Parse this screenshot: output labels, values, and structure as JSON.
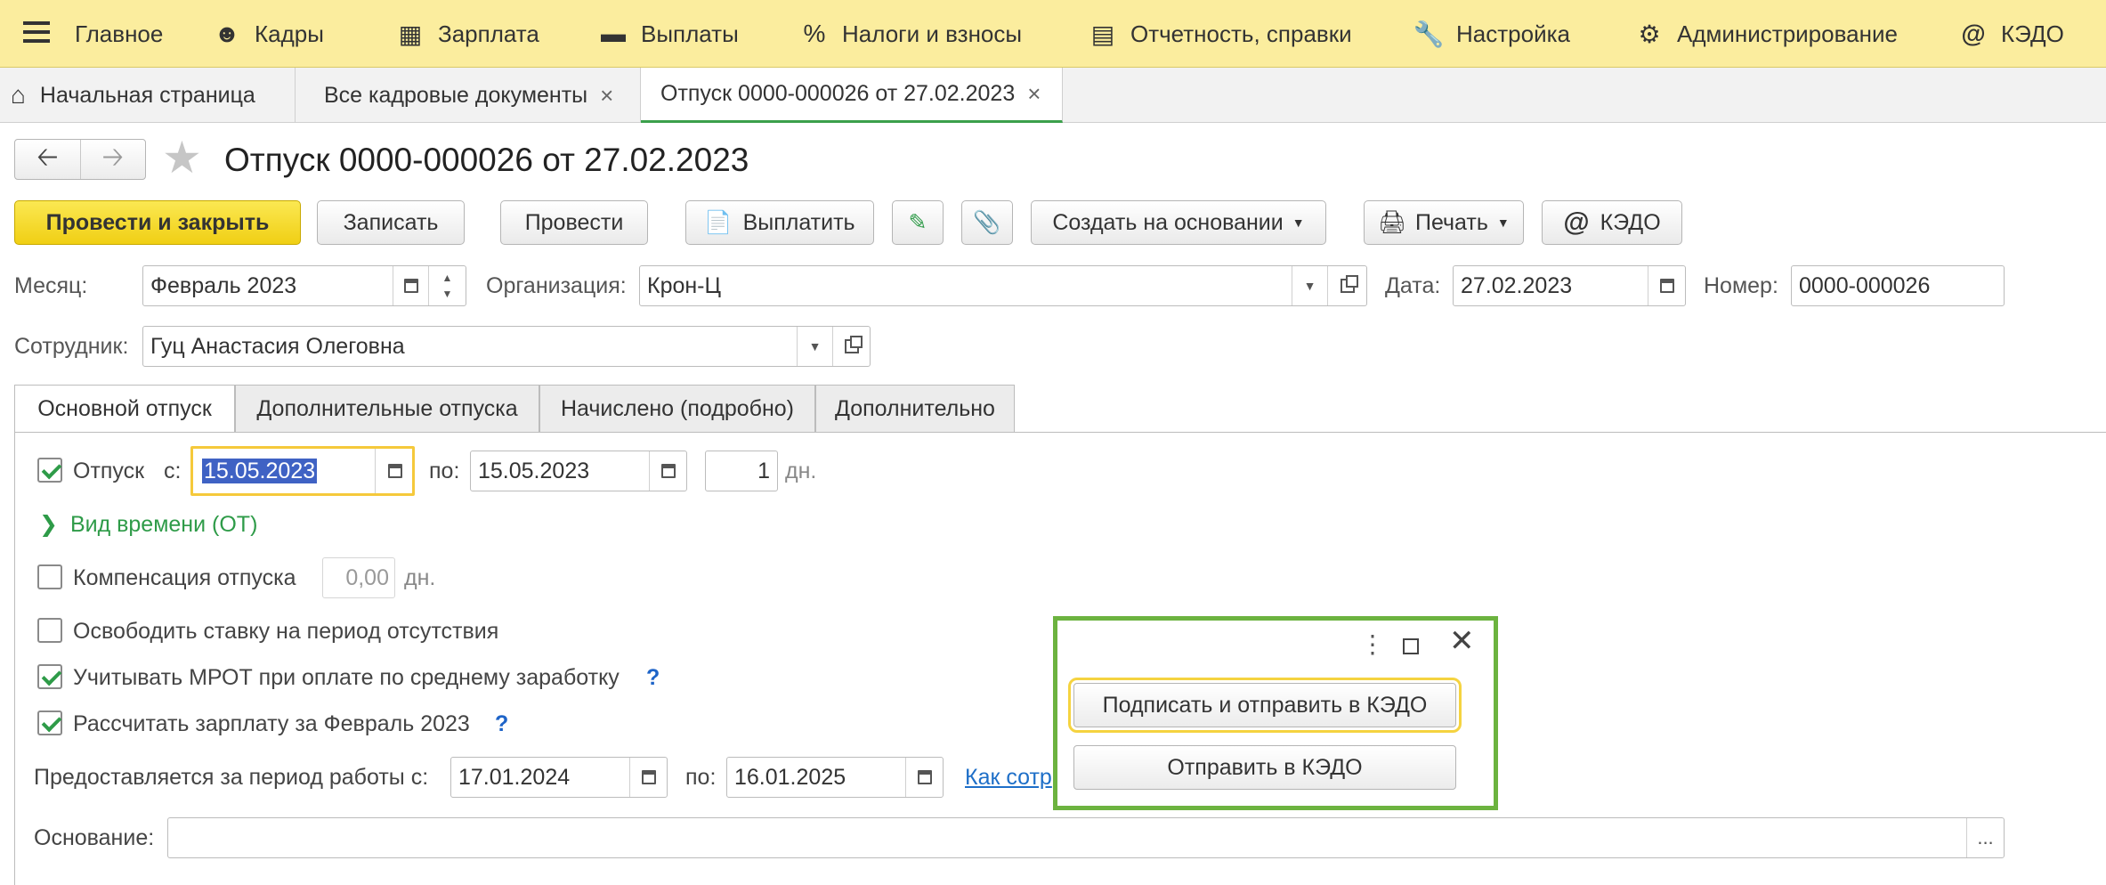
{
  "menu": {
    "items": [
      {
        "icon": "menu-icon",
        "label": "Главное"
      },
      {
        "icon": "people-icon",
        "label": "Кадры"
      },
      {
        "icon": "calculator-icon",
        "label": "Зарплата"
      },
      {
        "icon": "wallet-icon",
        "label": "Выплаты"
      },
      {
        "icon": "percent-icon",
        "label": "Налоги и взносы"
      },
      {
        "icon": "reports-icon",
        "label": "Отчетность, справки"
      },
      {
        "icon": "wrench-icon",
        "label": "Настройка"
      },
      {
        "icon": "gear-icon",
        "label": "Администрирование"
      },
      {
        "icon": "at-icon",
        "label": "КЭДО"
      }
    ]
  },
  "tabs": [
    {
      "label": "Начальная страница",
      "icon": "home-icon"
    },
    {
      "label": "Все кадровые документы",
      "close": "×"
    },
    {
      "label": "Отпуск 0000-000026 от 27.02.2023",
      "close": "×",
      "active": true
    }
  ],
  "document": {
    "title": "Отпуск 0000-000026 от 27.02.2023",
    "toolbar": {
      "post_close": "Провести и закрыть",
      "save": "Записать",
      "post": "Провести",
      "pay": "Выплатить",
      "create_based": "Создать на основании",
      "print": "Печать",
      "kedo": "КЭДО"
    },
    "fields": {
      "month_label": "Месяц:",
      "month_value": "Февраль 2023",
      "org_label": "Организация:",
      "org_value": "Крон-Ц",
      "date_label": "Дата:",
      "date_value": "27.02.2023",
      "number_label": "Номер:",
      "number_value": "0000-000026",
      "employee_label": "Сотрудник:",
      "employee_value": "Гуц Анастасия Олеговна"
    },
    "form_tabs": [
      "Основной отпуск",
      "Дополнительные отпуска",
      "Начислено (подробно)",
      "Дополнительно"
    ],
    "vacation": {
      "label": "Отпуск",
      "from_label": "с:",
      "from_value": "15.05.2023",
      "to_label": "по:",
      "to_value": "15.05.2023",
      "days_value": "1",
      "days_unit": "дн.",
      "time_type": "Вид времени (ОТ)",
      "compensation_label": "Компенсация отпуска",
      "compensation_value": "0,00",
      "compensation_unit": "дн.",
      "release_rate": "Освободить ставку на период отсутствия",
      "mrot": "Учитывать МРОТ при оплате по среднему заработку",
      "calc_salary": "Рассчитать зарплату за Февраль 2023",
      "help": "?",
      "period_label": "Предоставляется за период работы с:",
      "period_from": "17.01.2024",
      "period_to_label": "по:",
      "period_to": "16.01.2025",
      "link": "Как сотр",
      "basis_label": "Основание:",
      "basis_value": "",
      "basis_btn": "..."
    }
  },
  "popup": {
    "sign_send": "Подписать и отправить в КЭДО",
    "send": "Отправить в КЭДО"
  }
}
